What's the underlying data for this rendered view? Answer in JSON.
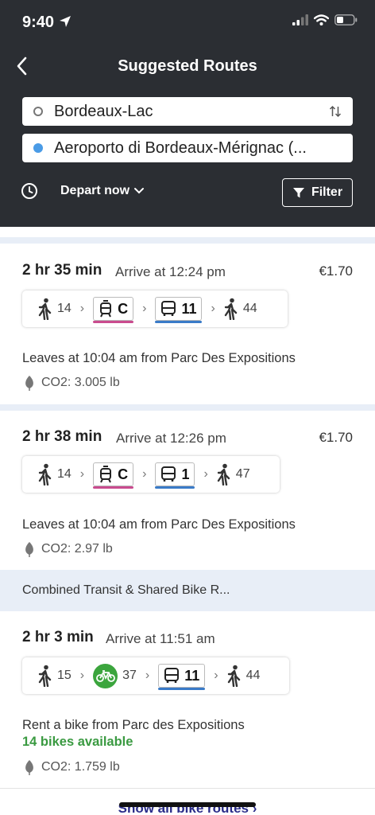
{
  "status": {
    "time": "9:40"
  },
  "header": {
    "title": "Suggested Routes",
    "origin": "Bordeaux-Lac",
    "destination": "Aeroporto di Bordeaux-Mérignac (...",
    "depart_label": "Depart now",
    "filter_label": "Filter"
  },
  "routes": [
    {
      "duration": "2 hr 35 min",
      "arrive": "Arrive at 12:24 pm",
      "price": "€1.70",
      "walk1": "14",
      "tram": "C",
      "bus": "11",
      "walk2": "44",
      "leaves": "Leaves at 10:04 am from Parc Des Expositions",
      "co2": "CO2: 3.005 lb"
    },
    {
      "duration": "2 hr 38 min",
      "arrive": "Arrive at 12:26 pm",
      "price": "€1.70",
      "walk1": "14",
      "tram": "C",
      "bus": "1",
      "walk2": "47",
      "leaves": "Leaves at 10:04 am from Parc Des Expositions",
      "co2": "CO2: 2.97 lb"
    }
  ],
  "combined_section": "Combined Transit & Shared Bike R...",
  "bike_route": {
    "duration": "2 hr 3 min",
    "arrive": "Arrive at 11:51 am",
    "walk1": "15",
    "bike": "37",
    "bus": "11",
    "walk2": "44",
    "info": "Rent a bike from Parc des Expositions",
    "available": "14 bikes available",
    "co2": "CO2: 1.759 lb"
  },
  "show_all": "Show all bike routes",
  "colors": {
    "tram": "#c94b8e",
    "bus": "#3a7bc8",
    "bike": "#3ba53d",
    "available": "#3a9a41"
  }
}
